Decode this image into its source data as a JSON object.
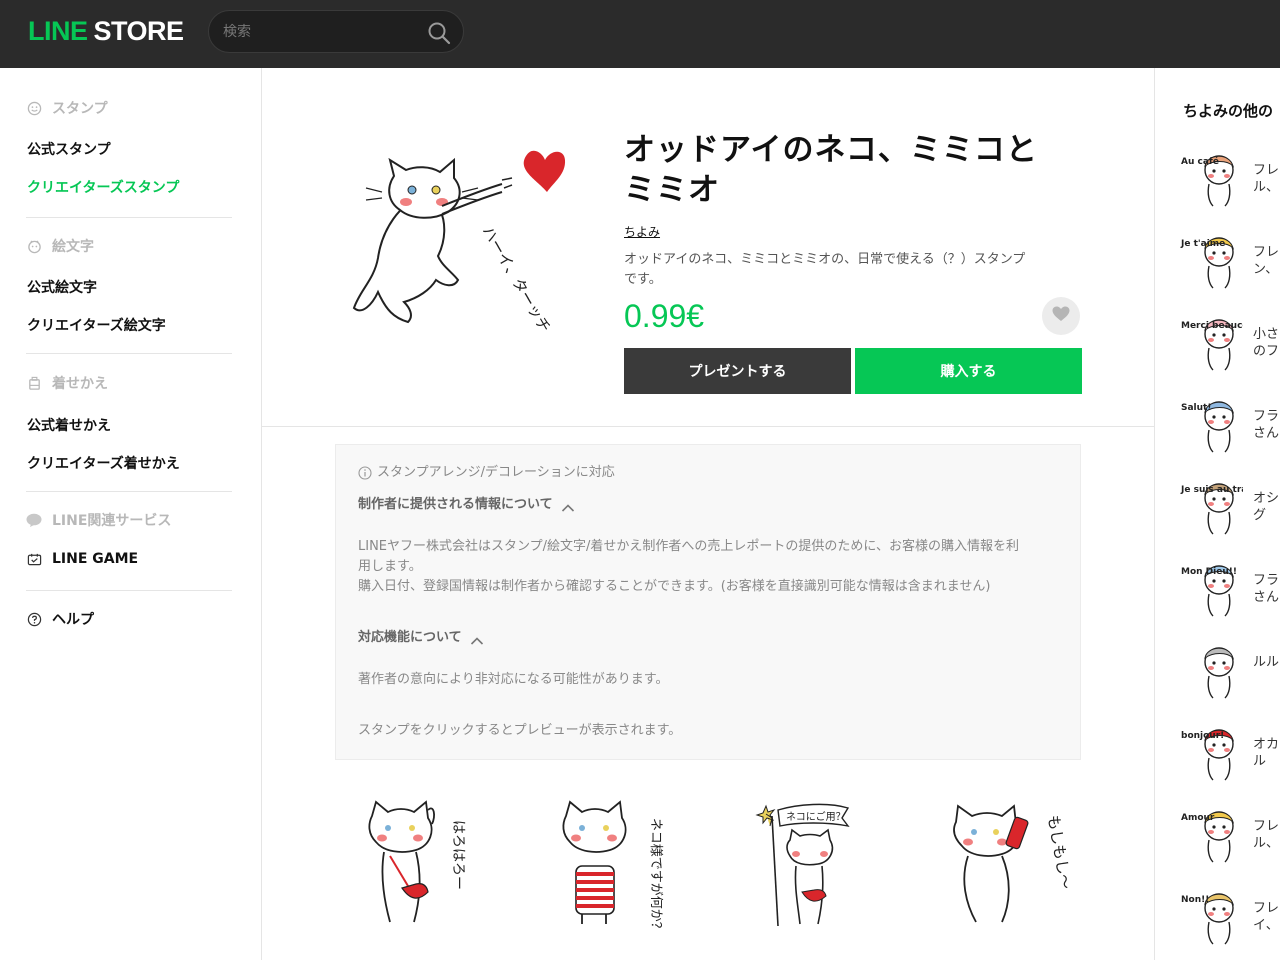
{
  "header": {
    "logo_line": "LINE",
    "logo_store": "STORE",
    "search_placeholder": "検索"
  },
  "sidebar": {
    "stamp_heading": "スタンプ",
    "stamp_items": [
      "公式スタンプ",
      "クリエイターズスタンプ"
    ],
    "emoji_heading": "絵文字",
    "emoji_items": [
      "公式絵文字",
      "クリエイターズ絵文字"
    ],
    "theme_heading": "着せかえ",
    "theme_items": [
      "公式着せかえ",
      "クリエイターズ着せかえ"
    ],
    "services_heading": "LINE関連サービス",
    "line_game": "LINE GAME",
    "help": "ヘルプ"
  },
  "product": {
    "title_line1": "オッドアイのネコ、ミミコと",
    "title_line2": "ミミオ",
    "author": "ちよみ",
    "desc_line1": "オッドアイのネコ、ミミコとミミオの、日常で使える（？）スタンプ",
    "desc_line2": "です。",
    "price": "0.99€",
    "gift_label": "プレゼントする",
    "buy_label": "購入する"
  },
  "info": {
    "arrange_note": "スタンプアレンジ/デコレーションに対応",
    "creator_heading": "制作者に提供される情報について",
    "creator_text_1": "LINEヤフー株式会社はスタンプ/絵文字/着せかえ制作者への売上レポートの提供のために、お客様の購入情報を利",
    "creator_text_2": "用します。",
    "creator_text_3": "購入日付、登録国情報は制作者から確認することができます。(お客様を直接識別可能な情報は含まれません)",
    "feature_heading": "対応機能について",
    "feature_text": "著作者の意向により非対応になる可能性があります。",
    "preview_hint": "スタンプをクリックするとプレビューが表示されます。"
  },
  "stickers": [
    {
      "text": "はろはろー"
    },
    {
      "text": "ネコ様ですが何か？"
    },
    {
      "text": "ネコにご用？"
    },
    {
      "text": "もしもし〜"
    }
  ],
  "hero_text": "ハーイ、ターッチ",
  "related": {
    "title": "ちよみの他の",
    "items": [
      {
        "caption": "Au café",
        "text_1": "フレ",
        "text_2": "ル、"
      },
      {
        "caption": "Je t'aime",
        "text_1": "フレ",
        "text_2": "ン、"
      },
      {
        "caption": "Merci beaucoup",
        "text_1": "小さ",
        "text_2": "のフ"
      },
      {
        "caption": "Salut!",
        "text_1": "フラ",
        "text_2": "さん"
      },
      {
        "caption": "Je suis au travail",
        "text_1": "オシ",
        "text_2": "グ"
      },
      {
        "caption": "Mon Dieu!!",
        "text_1": "フラ",
        "text_2": "さん"
      },
      {
        "caption": "",
        "text_1": "ルル",
        "text_2": ""
      },
      {
        "caption": "bonjour!",
        "text_1": "オカ",
        "text_2": "ル"
      },
      {
        "caption": "Amour",
        "text_1": "フレ",
        "text_2": "ル、"
      },
      {
        "caption": "Non!!",
        "text_1": "フレ",
        "text_2": "イ、"
      }
    ]
  },
  "colors": {
    "brand_green": "#06c755",
    "header_bg": "#2b2b2b",
    "gift_button": "#3a3a3a",
    "heart": "#d9262b",
    "cheek": "#f08080"
  }
}
